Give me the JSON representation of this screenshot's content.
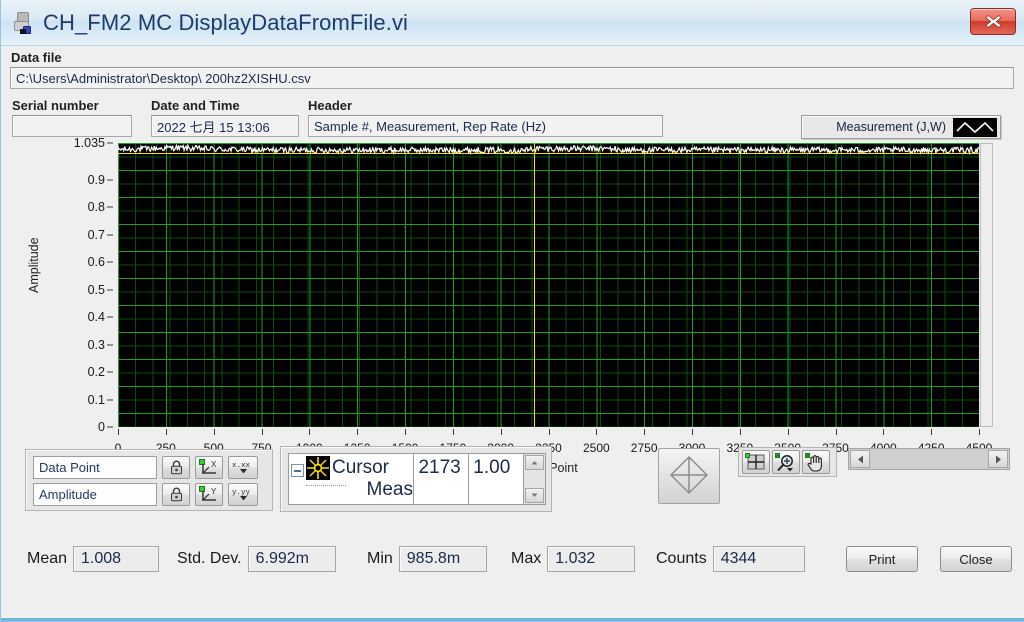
{
  "window": {
    "title": "CH_FM2 MC DisplayDataFromFile.vi",
    "icon": "labview-vi-icon",
    "close_label": "✕"
  },
  "datafile": {
    "label": "Data file",
    "value": "C:\\Users\\Administrator\\Desktop\\ 200hz2XISHU.csv"
  },
  "fields": {
    "serial_label": "Serial number",
    "serial_value": "",
    "datetime_label": "Date and Time",
    "datetime_value": "2022 七月 15 13:06",
    "header_label": "Header",
    "header_value": "Sample #, Measurement, Rep Rate (Hz)"
  },
  "legend": {
    "plot_name": "Measurement (J,W)",
    "trace_color": "#ffffff",
    "swatch_bg": "#000000"
  },
  "chart_data": {
    "type": "line",
    "title": "",
    "xlabel": "Data Point",
    "ylabel": "Amplitude",
    "xlim": [
      0,
      4500
    ],
    "ylim": [
      0,
      1.035
    ],
    "grid": true,
    "plot_bg": "#000000",
    "grid_major_color": "#1f9e1f",
    "grid_minor_color": "#0b4d0b",
    "xticks": [
      0,
      250,
      500,
      750,
      1000,
      1250,
      1500,
      1750,
      2000,
      2250,
      2500,
      2750,
      3000,
      3250,
      3500,
      3750,
      4000,
      4250,
      4500
    ],
    "yticks": [
      0,
      0.1,
      0.2,
      0.3,
      0.4,
      0.5,
      0.6,
      0.7,
      0.8,
      0.9,
      1.035
    ],
    "ytick_labels": [
      "0",
      "0.1",
      "0.2",
      "0.3",
      "0.4",
      "0.5",
      "0.6",
      "0.7",
      "0.8",
      "0.9",
      "1.035"
    ],
    "series": [
      {
        "name": "Measurement (J,W)",
        "color": "#ffffff",
        "mean": 1.008,
        "std": 0.006992,
        "min": 0.9858,
        "max": 1.032,
        "n_points": 4344
      }
    ],
    "cursors": [
      {
        "name": "Cursor",
        "x": 2173,
        "y": 1.0,
        "color": "#ffe000"
      }
    ]
  },
  "scale_controls": {
    "x": {
      "name": "Data Point",
      "lock_icon": "lock-icon",
      "autoscale_icon": "autoscale-x-icon",
      "format_icon": "x-format-icon",
      "format_label": "x.xx"
    },
    "y": {
      "name": "Amplitude",
      "lock_icon": "lock-icon",
      "autoscale_icon": "autoscale-y-icon",
      "format_icon": "y-format-icon",
      "format_label": "y.yy"
    }
  },
  "cursor_legend": {
    "name_row1": "Cursor",
    "name_row2": "Meas",
    "x_value": "2173",
    "y_value": "1.00",
    "glyph": "cursor-crosshair-icon"
  },
  "graph_tools": {
    "cursor_pad": "cursor-move-pad",
    "items": [
      {
        "name": "crosshair-cursor-tool",
        "active": true
      },
      {
        "name": "zoom-tool",
        "active": false
      },
      {
        "name": "pan-tool",
        "active": false
      }
    ]
  },
  "scrollbar": {
    "left_arrow": "◄",
    "right_arrow": "►"
  },
  "stats": {
    "mean_label": "Mean",
    "mean_value": "1.008",
    "std_label": "Std. Dev.",
    "std_value": "6.992m",
    "min_label": "Min",
    "min_value": "985.8m",
    "max_label": "Max",
    "max_value": "1.032",
    "counts_label": "Counts",
    "counts_value": "4344"
  },
  "buttons": {
    "print": "Print",
    "close": "Close"
  }
}
